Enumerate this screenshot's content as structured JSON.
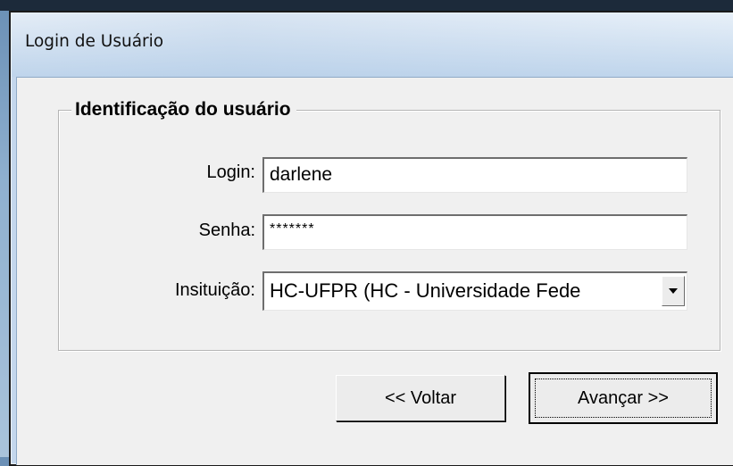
{
  "window": {
    "title": "Login de Usuário"
  },
  "group": {
    "legend": "Identificação do usuário"
  },
  "fields": {
    "login": {
      "label": "Login:",
      "value": "darlene"
    },
    "senha": {
      "label": "Senha:",
      "value": "*******"
    },
    "instituicao": {
      "label": "Insituição:",
      "value": "HC-UFPR (HC - Universidade Fede"
    }
  },
  "buttons": {
    "back": "<< Voltar",
    "next": "Avançar >>"
  },
  "icons": {
    "dropdown": "chevron-down-icon"
  }
}
